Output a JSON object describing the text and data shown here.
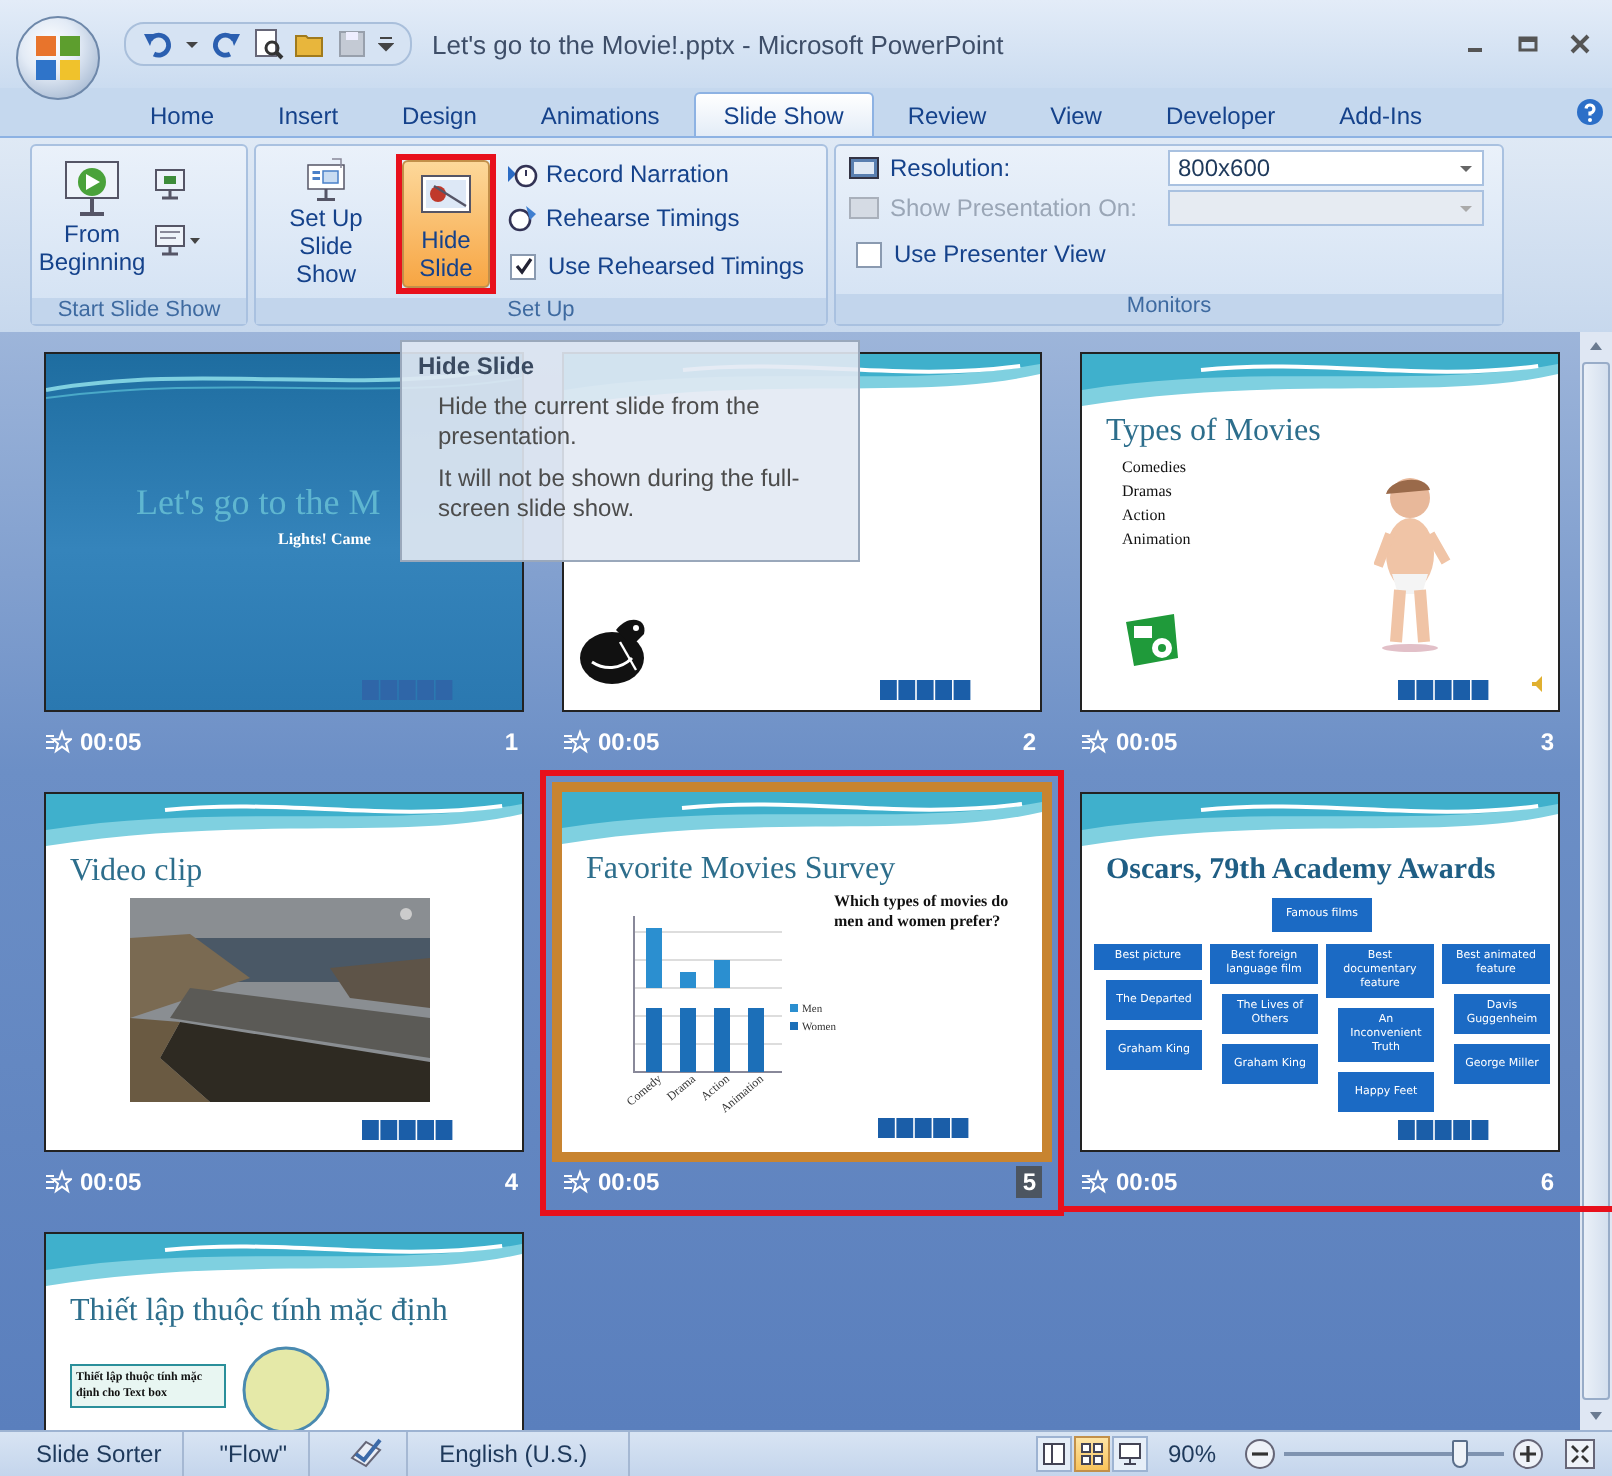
{
  "window": {
    "title": "Let's go to the Movie!.pptx - Microsoft PowerPoint"
  },
  "tabs": [
    {
      "label": "Home",
      "selected": false
    },
    {
      "label": "Insert",
      "selected": false
    },
    {
      "label": "Design",
      "selected": false
    },
    {
      "label": "Animations",
      "selected": false
    },
    {
      "label": "Slide Show",
      "selected": true
    },
    {
      "label": "Review",
      "selected": false
    },
    {
      "label": "View",
      "selected": false
    },
    {
      "label": "Developer",
      "selected": false
    },
    {
      "label": "Add-Ins",
      "selected": false
    }
  ],
  "start_group": {
    "label": "Start Slide Show",
    "from_beginning": "From Beginning"
  },
  "setup_group": {
    "label": "Set Up",
    "setup_button": "Set Up Slide Show",
    "hide_button": {
      "label": "Hide Slide",
      "active": true,
      "highlighted": true
    },
    "record": "Record Narration",
    "rehearse": "Rehearse Timings",
    "use_timings": {
      "label": "Use Rehearsed Timings",
      "checked": true
    }
  },
  "monitors_group": {
    "label": "Monitors",
    "resolution_label": "Resolution:",
    "resolution_value": "800x600",
    "show_on_label": "Show Presentation On:",
    "show_on_disabled": true,
    "presenter_view": {
      "label": "Use Presenter View",
      "checked": false
    }
  },
  "tooltip": {
    "title": "Hide Slide",
    "lines": [
      "Hide the current slide from the presentation.",
      "It will not be shown during the full-screen slide show."
    ]
  },
  "slides": [
    {
      "kind": "title",
      "title": "Let's go to the M",
      "subtitle": "Lights! Came",
      "timing": "00:05",
      "number": "1",
      "selected": false
    },
    {
      "kind": "clipart",
      "timing": "00:05",
      "number": "2",
      "selected": false
    },
    {
      "kind": "bullets",
      "title": "Types of Movies",
      "bullets": [
        "Comedies",
        "Dramas",
        "Action",
        "Animation"
      ],
      "timing": "00:05",
      "number": "3",
      "selected": false
    },
    {
      "kind": "video",
      "title": "Video clip",
      "timing": "00:05",
      "number": "4",
      "selected": false
    },
    {
      "kind": "chart",
      "title": "Favorite Movies Survey",
      "bullet": "Which types of movies do men and women prefer?",
      "categories": [
        "Comedy",
        "Drama",
        "Action",
        "Animation"
      ],
      "legend": [
        "Men",
        "Women"
      ],
      "timing": "00:05",
      "number": "5",
      "selected": true,
      "highlighted": true
    },
    {
      "kind": "orgchart",
      "title": "Oscars, 79th Academy Awards",
      "root": "Famous films",
      "columns": [
        {
          "head": "Best picture",
          "items": [
            "The Departed",
            "Graham King"
          ]
        },
        {
          "head": "Best foreign language film",
          "items": [
            "The Lives of Others",
            "Graham King"
          ]
        },
        {
          "head": "Best documentary feature",
          "items": [
            "An Inconvenient Truth",
            "Happy Feet"
          ]
        },
        {
          "head": "Best animated feature",
          "items": [
            "Davis Guggenheim",
            "George Miller"
          ]
        }
      ],
      "timing": "00:05",
      "number": "6",
      "selected": false
    },
    {
      "kind": "textbox",
      "title": "Thiết lập thuộc tính mặc định",
      "box_text": "Thiết lập thuộc tính mặc định cho Text box",
      "selected": false
    }
  ],
  "status_bar": {
    "view": "Slide Sorter",
    "theme": "\"Flow\"",
    "language": "English (U.S.)",
    "views": [
      {
        "selected": false
      },
      {
        "selected": true
      },
      {
        "selected": false
      }
    ],
    "zoom": "90%",
    "zoom_slider": {
      "level": 0.8
    }
  }
}
